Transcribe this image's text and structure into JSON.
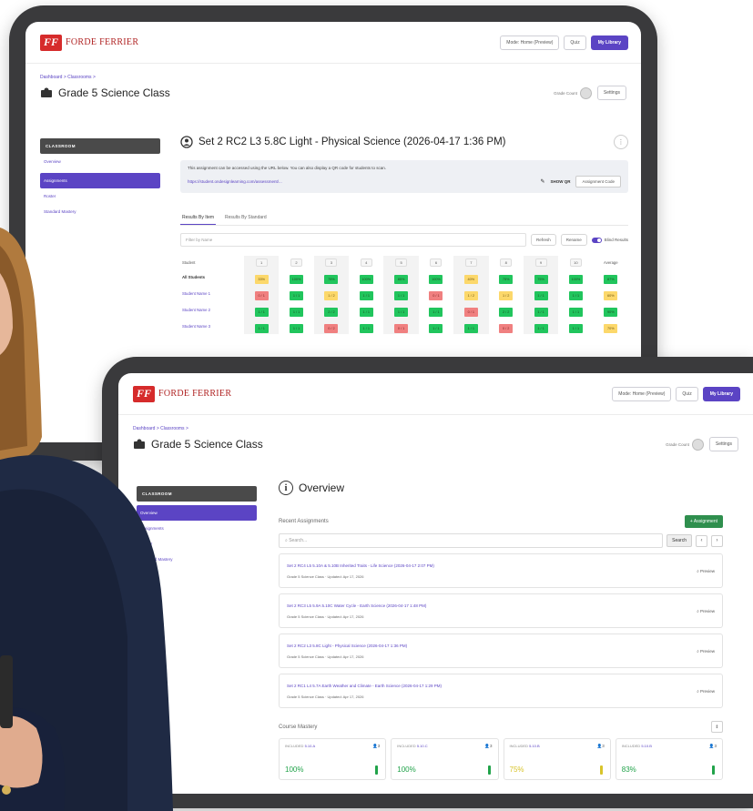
{
  "brand": {
    "logo_mark": "FF",
    "name": "FORDE FERRIER",
    "primary": "#5b44c4",
    "logo_red": "#d62b2b"
  },
  "topbar": {
    "preview_btn": "Mode: Home (Preview)",
    "quiz_btn": "Quiz",
    "library_btn": "My Library"
  },
  "breadcrumb": "Dashboard  >  Classrooms  >",
  "class": {
    "title": "Grade 5 Science Class",
    "grade_label": "Grade Count",
    "settings": "Settings"
  },
  "sidebar": {
    "header": "CLASSROOM",
    "items": [
      "Overview",
      "Assignments",
      "Roster",
      "Standard Mastery"
    ]
  },
  "assignment": {
    "title": "Set 2 RC2 L3 5.8C Light - Physical Science (2026-04-17 1:36 PM)",
    "info_text": "This assignment can be accessed using the URL below. You can also display a QR code for students to scan.",
    "url": "https://student.ondesignlearning.com/assessment/...",
    "qr_label": "SHOW QR",
    "assignment_code": "Assignment Code",
    "tabs": [
      "Results By Item",
      "Results By Standard"
    ],
    "filter_placeholder": "Filter by Name",
    "btn_refresh": "Refresh",
    "btn_rename": "Rename",
    "toggle_label": "Blind Results",
    "grid": {
      "student_header": "Student",
      "average_header": "Average",
      "questions": [
        "1",
        "2",
        "3",
        "4",
        "5",
        "6",
        "7",
        "8",
        "9",
        "10"
      ],
      "rows": [
        {
          "name": "All Students",
          "cells": [
            [
              "y",
              "33%"
            ],
            [
              "g",
              "100%"
            ],
            [
              "g",
              "75%"
            ],
            [
              "g",
              "100%"
            ],
            [
              "g",
              "85%"
            ],
            [
              "g",
              "100%"
            ],
            [
              "y",
              "40%"
            ],
            [
              "g",
              "75%"
            ],
            [
              "g",
              "75%"
            ],
            [
              "g",
              "100%"
            ]
          ],
          "avg": [
            "g",
            "87%"
          ]
        },
        {
          "name": "Student Name 1",
          "cells": [
            [
              "r",
              "0 / 1"
            ],
            [
              "g",
              "1 / 1"
            ],
            [
              "y",
              "1 / 2"
            ],
            [
              "g",
              "1 / 1"
            ],
            [
              "g",
              "1 / 1"
            ],
            [
              "r",
              "0 / 1"
            ],
            [
              "y",
              "1 / 2"
            ],
            [
              "y",
              "1 / 2"
            ],
            [
              "g",
              "1 / 1"
            ],
            [
              "g",
              "1 / 1"
            ]
          ],
          "avg": [
            "y",
            "60%"
          ]
        },
        {
          "name": "Student Name 2",
          "cells": [
            [
              "g",
              "1 / 1"
            ],
            [
              "g",
              "1 / 1"
            ],
            [
              "g",
              "2 / 2"
            ],
            [
              "g",
              "1 / 1"
            ],
            [
              "g",
              "1 / 1"
            ],
            [
              "g",
              "1 / 1"
            ],
            [
              "r",
              "0 / 1"
            ],
            [
              "g",
              "2 / 2"
            ],
            [
              "g",
              "1 / 1"
            ],
            [
              "g",
              "1 / 1"
            ]
          ],
          "avg": [
            "g",
            "90%"
          ]
        },
        {
          "name": "Student Name 3",
          "cells": [
            [
              "g",
              "1 / 1"
            ],
            [
              "g",
              "1 / 1"
            ],
            [
              "r",
              "0 / 2"
            ],
            [
              "g",
              "1 / 1"
            ],
            [
              "r",
              "0 / 1"
            ],
            [
              "g",
              "1 / 1"
            ],
            [
              "g",
              "1 / 1"
            ],
            [
              "r",
              "0 / 2"
            ],
            [
              "g",
              "1 / 1"
            ],
            [
              "g",
              "1 / 1"
            ]
          ],
          "avg": [
            "y",
            "70%"
          ]
        }
      ]
    }
  },
  "overview": {
    "title": "Overview",
    "recent_label": "Recent Assignments",
    "add_btn": "+ Assignment",
    "search_placeholder": "Search...",
    "search_btn": "Search",
    "preview_label": "Preview",
    "items": [
      {
        "name": "Set 2 RC4 L5 5.10A & 5.10B Inherited Traits - Life Science (2026-04-17 2:07 PM)",
        "meta": "Grade 5 Science Class  ·  Updated: Apr 17, 2026"
      },
      {
        "name": "Set 2 RC3 L5 5.9A 5.10C Water Cycle - Earth Science (2026-04-17 1:48 PM)",
        "meta": "Grade 5 Science Class  ·  Updated: Apr 17, 2026"
      },
      {
        "name": "Set 2 RC2 L3 5.8C Light - Physical Science (2026-04-17 1:36 PM)",
        "meta": "Grade 5 Science Class  ·  Updated: Apr 17, 2026"
      },
      {
        "name": "Set 2 RC1 L4 5.7A Earth Weather and Climate - Earth Science (2026-04-17 1:29 PM)",
        "meta": "Grade 5 Science Class  ·  Updated: Apr 17, 2026"
      }
    ],
    "mastery_label": "Course Mastery",
    "mastery": [
      {
        "prefix": "INCLUDED",
        "code": "5.10.A",
        "count": "3",
        "pct": "100%",
        "status": "#21a34a"
      },
      {
        "prefix": "INCLUDED",
        "code": "5.10.C",
        "count": "3",
        "pct": "100%",
        "status": "#21a34a"
      },
      {
        "prefix": "INCLUDED",
        "code": "5.10.B",
        "count": "3",
        "pct": "75%",
        "status": "#d8c42a"
      },
      {
        "prefix": "INCLUDED",
        "code": "5.10.B",
        "count": "3",
        "pct": "83%",
        "status": "#21a34a"
      }
    ]
  }
}
